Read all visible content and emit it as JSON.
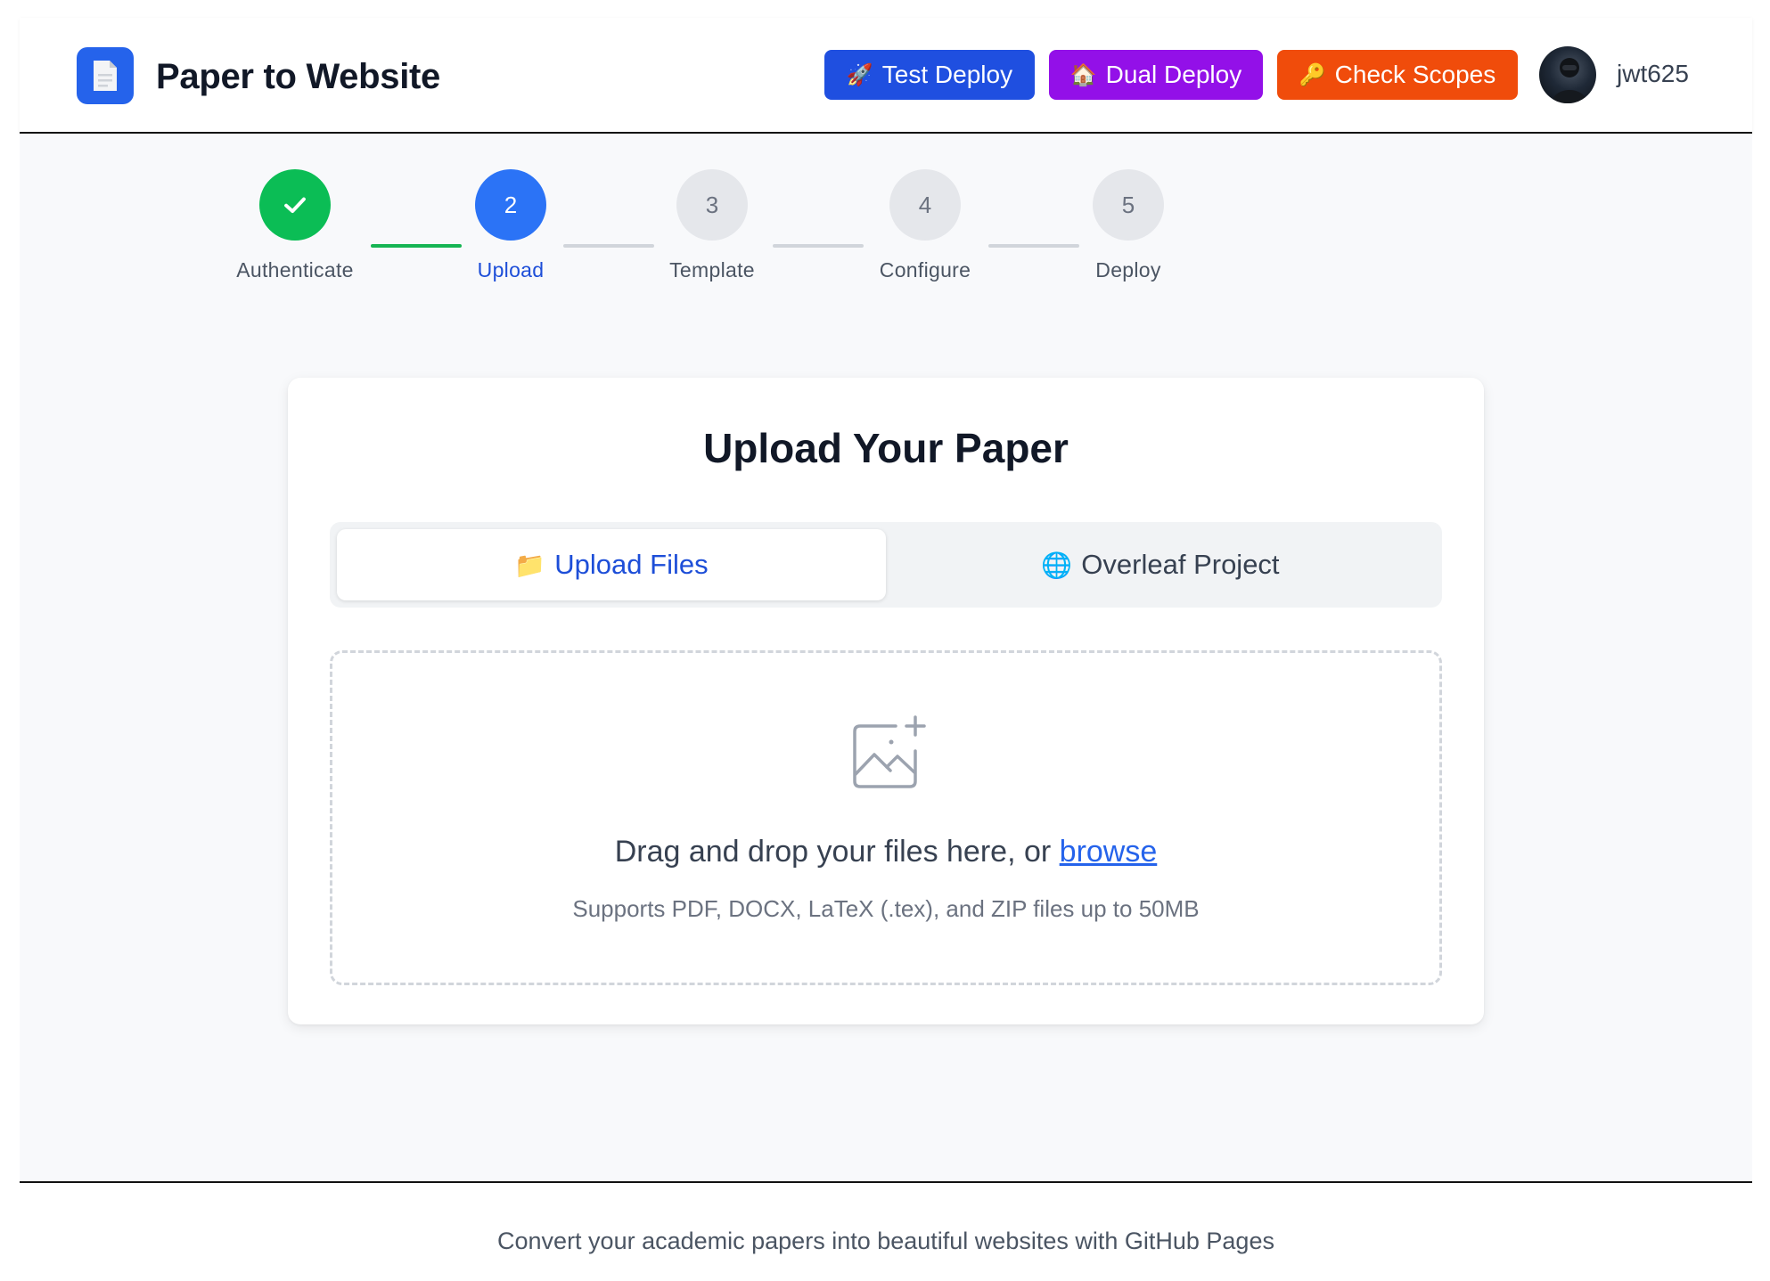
{
  "header": {
    "app_title": "Paper to Website",
    "buttons": {
      "test_deploy": {
        "emoji": "🚀",
        "label": "Test Deploy"
      },
      "dual_deploy": {
        "emoji": "🏠",
        "label": "Dual Deploy"
      },
      "check_scopes": {
        "emoji": "🔑",
        "label": "Check Scopes"
      }
    },
    "username": "jwt625"
  },
  "stepper": {
    "steps": [
      {
        "number": "✓",
        "label": "Authenticate",
        "state": "done"
      },
      {
        "number": "2",
        "label": "Upload",
        "state": "active"
      },
      {
        "number": "3",
        "label": "Template",
        "state": "idle"
      },
      {
        "number": "4",
        "label": "Configure",
        "state": "idle"
      },
      {
        "number": "5",
        "label": "Deploy",
        "state": "idle"
      }
    ]
  },
  "card": {
    "title": "Upload Your Paper",
    "tabs": {
      "upload": {
        "emoji": "📁",
        "label": "Upload Files",
        "selected": true
      },
      "overleaf": {
        "emoji": "🌐",
        "label": "Overleaf Project",
        "selected": false
      }
    },
    "dropzone": {
      "prompt": "Drag and drop your files here, or ",
      "browse": "browse",
      "hint": "Supports PDF, DOCX, LaTeX (.tex), and ZIP files up to 50MB"
    }
  },
  "footer": {
    "text": "Convert your academic papers into beautiful websites with GitHub Pages"
  },
  "colors": {
    "primary": "#2563eb",
    "success": "#0bbd55",
    "test_deploy": "#1f4fe0",
    "dual_deploy": "#9310e8",
    "check_scopes": "#f04c0b"
  }
}
